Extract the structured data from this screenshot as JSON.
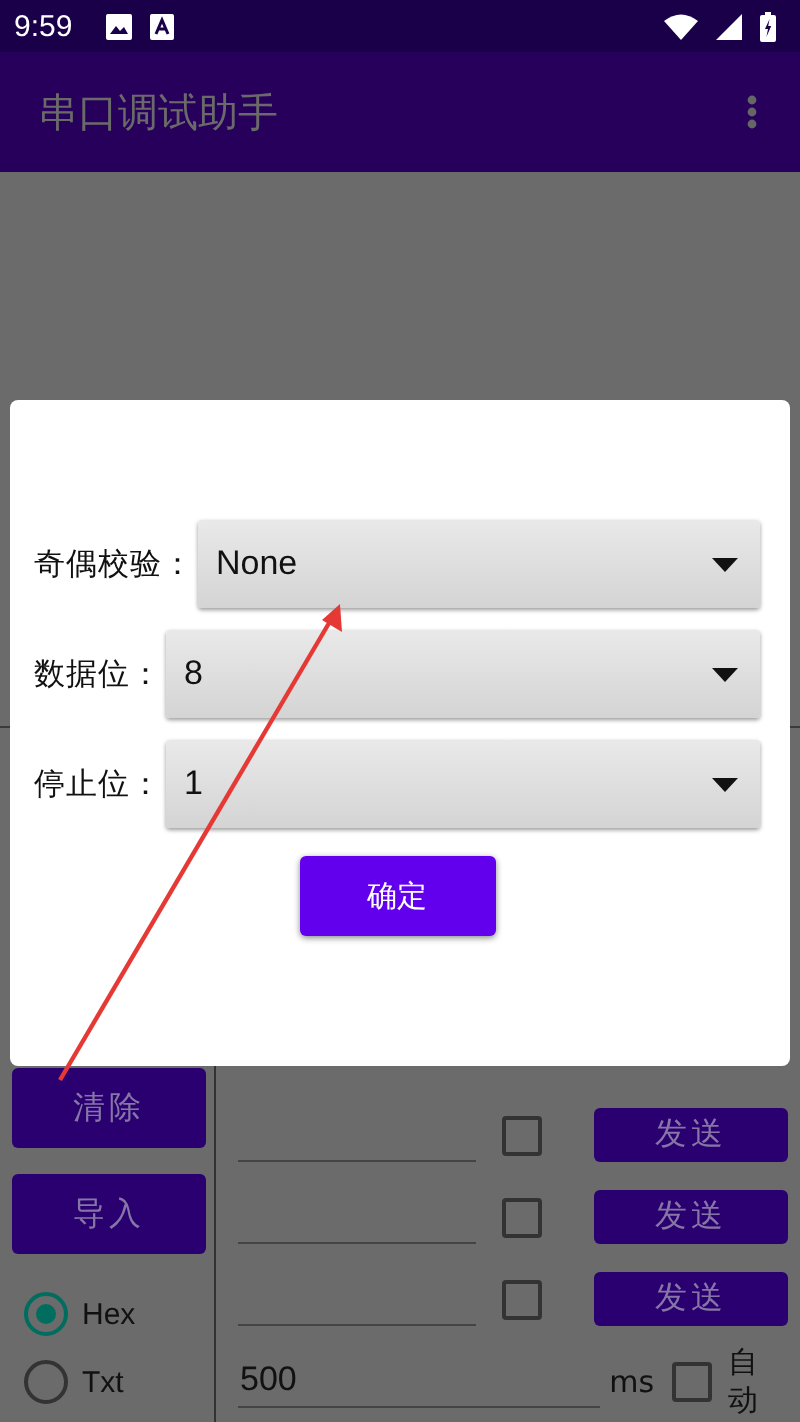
{
  "status_bar": {
    "time": "9:59"
  },
  "app_bar": {
    "title": "串口调试助手"
  },
  "dialog": {
    "fields": [
      {
        "label": "奇偶校验：",
        "value": "None"
      },
      {
        "label": "数据位：",
        "value": "8"
      },
      {
        "label": "停止位：",
        "value": "1"
      }
    ],
    "confirm": "确定"
  },
  "side_buttons": [
    "清除",
    "导入"
  ],
  "radios": [
    {
      "label": "Hex",
      "selected": true
    },
    {
      "label": "Txt",
      "selected": false
    }
  ],
  "send_rows": [
    {
      "checked": false,
      "button": "发送"
    },
    {
      "checked": false,
      "button": "发送"
    },
    {
      "checked": false,
      "button": "发送"
    }
  ],
  "interval": {
    "value": "500",
    "unit": "ms",
    "auto_label": "自动",
    "auto_checked": false
  }
}
